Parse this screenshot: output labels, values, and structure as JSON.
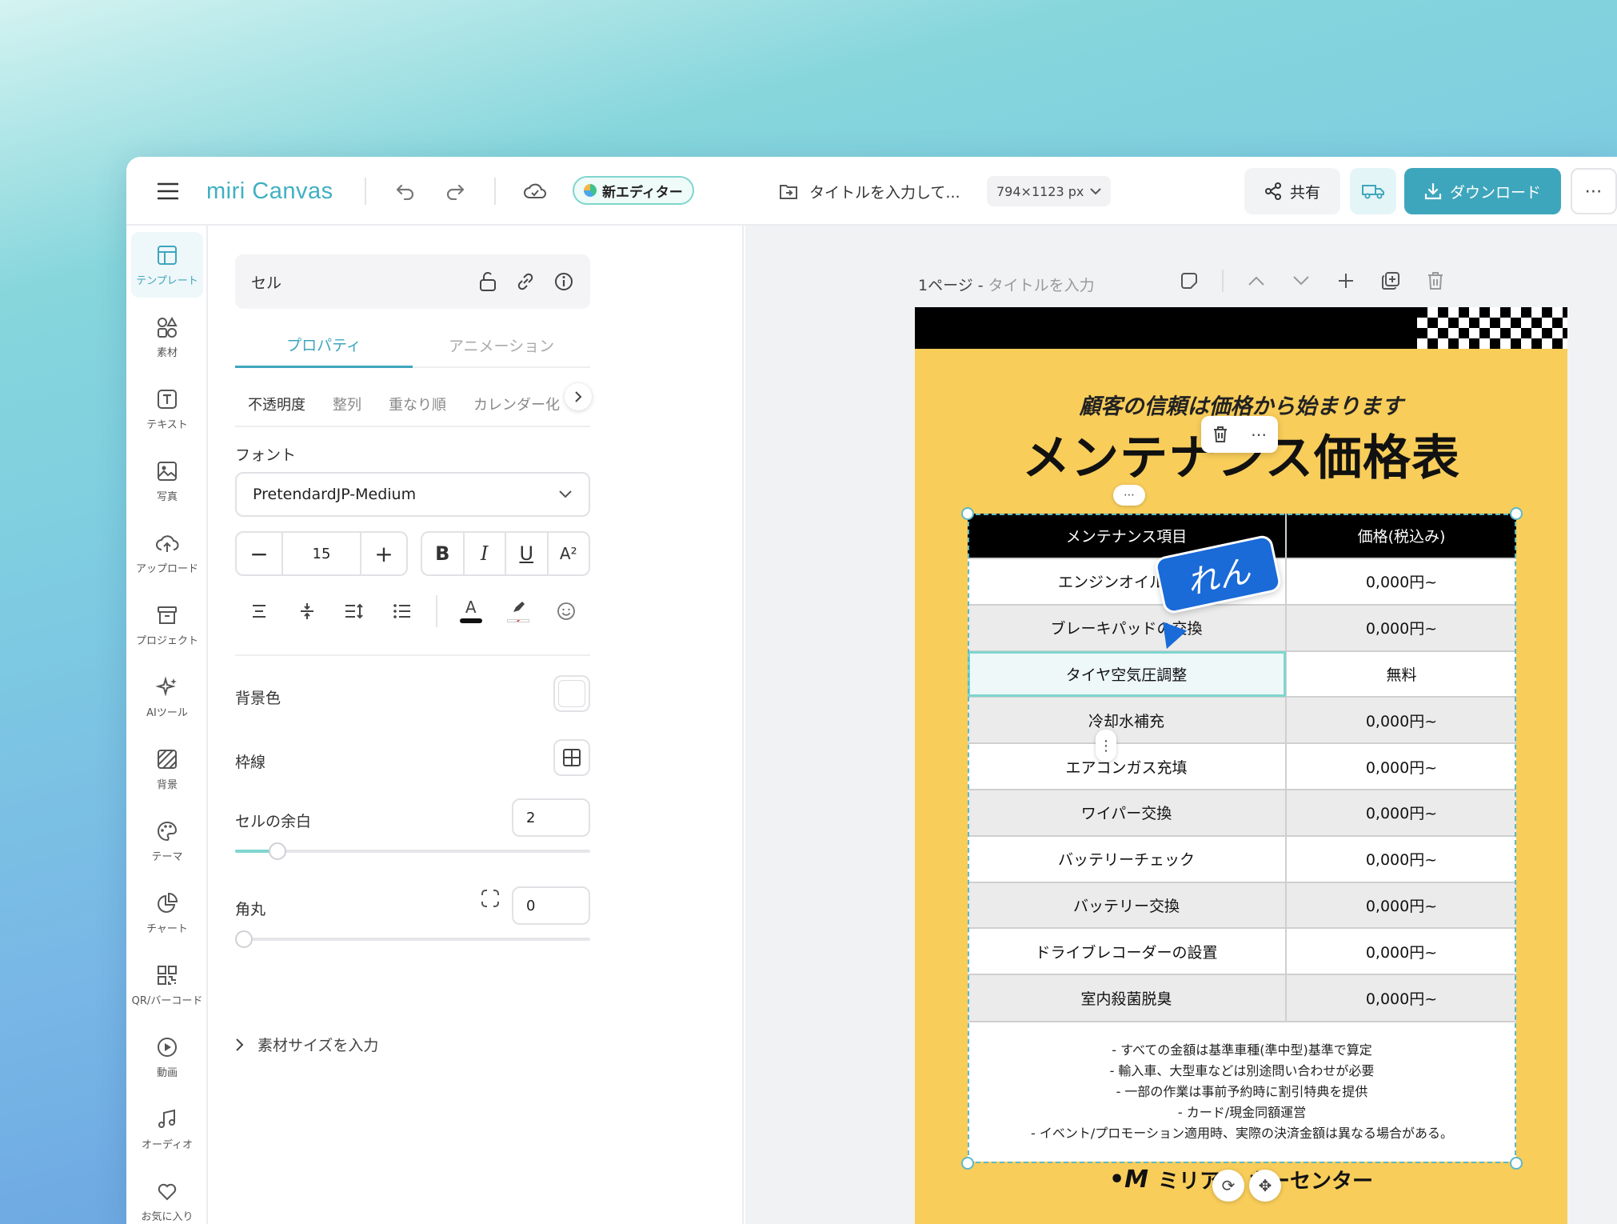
{
  "app": {
    "logo": "miri Canvas",
    "new_editor_label": "新エディター",
    "title_placeholder": "タイトルを入力して...",
    "canvas_size": "794×1123 px",
    "share_label": "共有",
    "download_label": "ダウンロード",
    "brand_color": "#3ea6bc"
  },
  "rail": {
    "items": [
      {
        "label": "テンプレート",
        "icon": "template-icon"
      },
      {
        "label": "素材",
        "icon": "elements-icon"
      },
      {
        "label": "テキスト",
        "icon": "text-icon"
      },
      {
        "label": "写真",
        "icon": "photo-icon"
      },
      {
        "label": "アップロード",
        "icon": "upload-icon"
      },
      {
        "label": "プロジェクト",
        "icon": "project-icon"
      },
      {
        "label": "AIツール",
        "icon": "ai-icon"
      },
      {
        "label": "背景",
        "icon": "background-icon"
      },
      {
        "label": "テーマ",
        "icon": "palette-icon"
      },
      {
        "label": "チャート",
        "icon": "chart-icon"
      },
      {
        "label": "QR/バーコード",
        "icon": "qr-icon"
      },
      {
        "label": "動画",
        "icon": "video-icon"
      },
      {
        "label": "オーディオ",
        "icon": "audio-icon"
      },
      {
        "label": "お気に入り",
        "icon": "heart-icon"
      }
    ]
  },
  "panel": {
    "header_label": "セル",
    "tabs": [
      "プロパティ",
      "アニメーション"
    ],
    "subtabs": [
      "不透明度",
      "整列",
      "重なり順",
      "カレンダー化"
    ],
    "font_label": "フォント",
    "font_value": "PretendardJP-Medium",
    "font_size": "15",
    "bg_label": "背景色",
    "border_label": "枠線",
    "padding_label": "セルの余白",
    "padding_value": "2",
    "radius_label": "角丸",
    "radius_value": "0",
    "size_link": "素材サイズを入力",
    "padding_slider_fraction": 0.12,
    "radius_slider_fraction": 0.0
  },
  "canvas": {
    "page_label": "1ページ - ",
    "page_title_placeholder": "タイトルを入力",
    "doc": {
      "subtitle": "顧客の信頼は価格から始まります",
      "title": "メンテナンス価格表",
      "headers": [
        "メンテナンス項目",
        "価格(税込み)"
      ],
      "rows": [
        [
          "エンジンオイル交換",
          "0,000円~"
        ],
        [
          "ブレーキパッドの交換",
          "0,000円~"
        ],
        [
          "タイヤ空気圧調整",
          "無料"
        ],
        [
          "冷却水補充",
          "0,000円~"
        ],
        [
          "エアコンガス充填",
          "0,000円~"
        ],
        [
          "ワイパー交換",
          "0,000円~"
        ],
        [
          "バッテリーチェック",
          "0,000円~"
        ],
        [
          "バッテリー交換",
          "0,000円~"
        ],
        [
          "ドライブレコーダーの設置",
          "0,000円~"
        ],
        [
          "室内殺菌脱臭",
          "0,000円~"
        ]
      ],
      "notes": [
        "- すべての金額は基準車種(準中型)基準で算定",
        "- 輸入車、大型車などは別途問い合わせが必要",
        "- 一部の作業は事前予約時に割引特典を提供",
        "- カード/現金同額運営",
        "- イベント/プロモーション適用時、実際の決済金額は異なる場合がある。"
      ],
      "footer": "ミリア一 カーセンター",
      "footer_logo": "•M",
      "bg_color": "#f8cd5a"
    },
    "collab_cursor_label": "れん"
  }
}
